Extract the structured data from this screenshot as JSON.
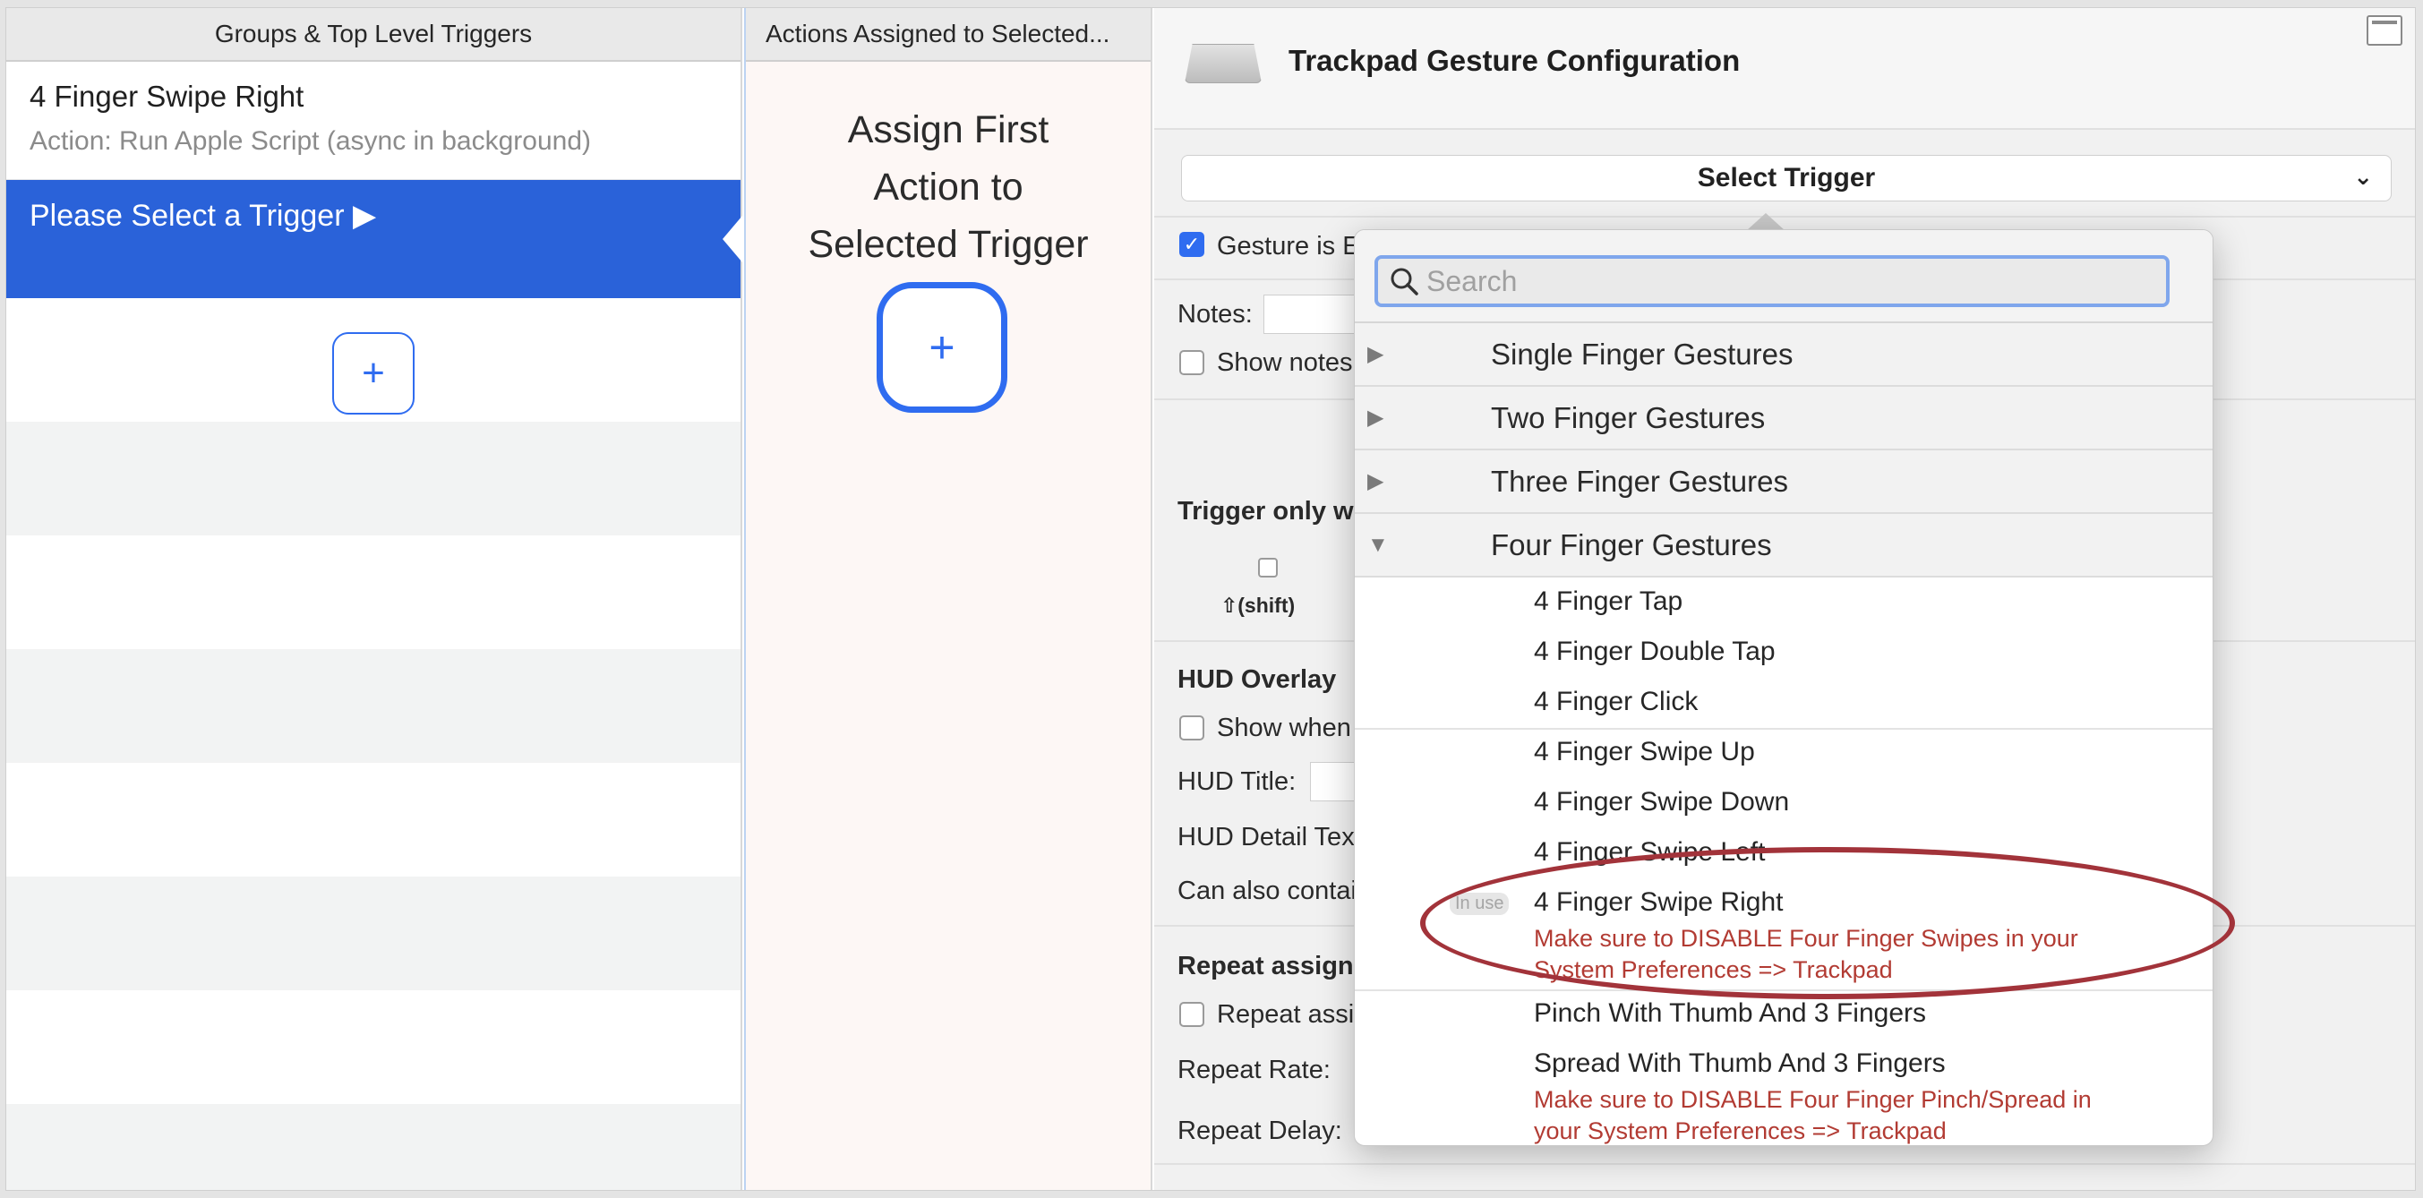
{
  "left_panel": {
    "header": "Groups & Top Level Triggers",
    "trigger": {
      "title": "4 Finger Swipe Right",
      "action": "Action: Run Apple Script (async in background)"
    },
    "selected_label": "Please Select a Trigger ▶",
    "add_button": "+"
  },
  "middle_panel": {
    "header": "Actions Assigned to Selected...",
    "assign_line1": "Assign First",
    "assign_line2": "Action to",
    "assign_line3": "Selected Trigger",
    "add_button": "+"
  },
  "config_panel": {
    "title": "Trackpad Gesture Configuration",
    "select_trigger": "Select Trigger",
    "gesture_enabled": "Gesture is E",
    "notes_label": "Notes:",
    "show_notes": "Show notes",
    "trigger_only": "Trigger only w",
    "shift_label": "⇧(shift)",
    "hud_overlay": "HUD Overlay",
    "show_when": "Show when",
    "hud_title": "HUD Title:",
    "hud_detail": "HUD Detail Tex",
    "can_also": "Can also contai",
    "repeat_assign_header": "Repeat assigne",
    "repeat_assign": "Repeat assig",
    "repeat_rate": "Repeat Rate:",
    "repeat_delay": "Repeat Delay:"
  },
  "dropdown": {
    "search_placeholder": "Search",
    "groups": [
      {
        "label": "Single Finger Gestures",
        "expanded": false
      },
      {
        "label": "Two Finger Gestures",
        "expanded": false
      },
      {
        "label": "Three Finger Gestures",
        "expanded": false
      },
      {
        "label": "Four Finger Gestures",
        "expanded": true
      }
    ],
    "items": [
      "4 Finger Tap",
      "4 Finger Double Tap",
      "4 Finger Click",
      "4 Finger Swipe Up",
      "4 Finger Swipe Down",
      "4 Finger Swipe Left",
      "4 Finger Swipe Right",
      "Pinch With Thumb And 3 Fingers",
      "Spread With Thumb And 3 Fingers"
    ],
    "in_use_badge": "In use",
    "warning_swipes_1": "Make sure to DISABLE Four Finger Swipes in your",
    "warning_swipes_2": "System Preferences => Trackpad",
    "warning_pinch_1": "Make sure to DISABLE Four Finger Pinch/Spread in",
    "warning_pinch_2": "your System Preferences => Trackpad"
  },
  "colors": {
    "selection_blue": "#2a62d9",
    "accent_blue": "#2f6cf0",
    "warning_red": "#b23b33",
    "annotation_ring": "#a2333a"
  }
}
